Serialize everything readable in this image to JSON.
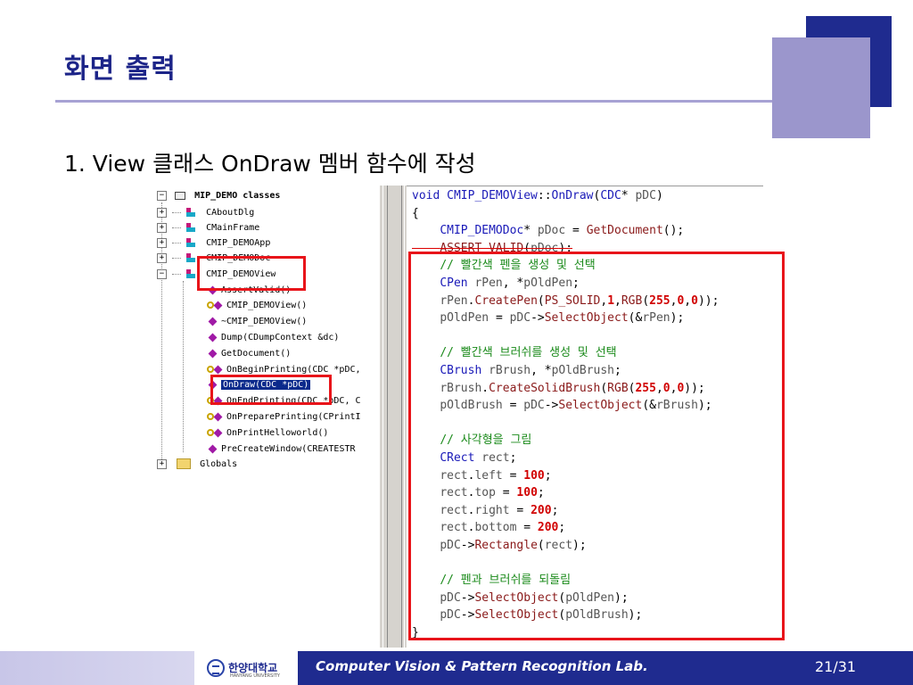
{
  "slide": {
    "title": "화면 출력",
    "subtitle": "1. View 클래스 OnDraw 멤버 함수에 작성"
  },
  "tree": {
    "root": "MIP_DEMO classes",
    "items": [
      {
        "label": "CAboutDlg",
        "kind": "class"
      },
      {
        "label": "CMainFrame",
        "kind": "class"
      },
      {
        "label": "CMIP_DEMOApp",
        "kind": "class"
      },
      {
        "label": "CMIP_DEMODoc",
        "kind": "class"
      },
      {
        "label": "CMIP_DEMOView",
        "kind": "class"
      },
      {
        "label": "AssertValid()",
        "kind": "method"
      },
      {
        "label": "CMIP_DEMOView()",
        "kind": "protected"
      },
      {
        "label": "~CMIP_DEMOView()",
        "kind": "method"
      },
      {
        "label": "Dump(CDumpContext &dc)",
        "kind": "method"
      },
      {
        "label": "GetDocument()",
        "kind": "method"
      },
      {
        "label": "OnBeginPrinting(CDC *pDC,",
        "kind": "protected"
      },
      {
        "label": "OnDraw(CDC *pDC)",
        "kind": "method-selected"
      },
      {
        "label": "OnEndPrinting(CDC *pDC, C",
        "kind": "protected"
      },
      {
        "label": "OnPreparePrinting(CPrintI",
        "kind": "protected"
      },
      {
        "label": "OnPrintHelloworld()",
        "kind": "protected"
      },
      {
        "label": "PreCreateWindow(CREATESTR",
        "kind": "method"
      },
      {
        "label": "Globals",
        "kind": "folder"
      }
    ]
  },
  "code": {
    "lines": [
      "void CMIP_DEMOView::OnDraw(CDC* pDC)",
      "{",
      "    CMIP_DEMODoc* pDoc = GetDocument();",
      "    ASSERT_VALID(pDoc);",
      "    // 빨간색 펜을 생성 및 선택",
      "    CPen rPen, *pOldPen;",
      "    rPen.CreatePen(PS_SOLID,1,RGB(255,0,0));",
      "    pOldPen = pDC->SelectObject(&rPen);",
      "",
      "    // 빨간색 브러쉬를 생성 및 선택",
      "    CBrush rBrush, *pOldBrush;",
      "    rBrush.CreateSolidBrush(RGB(255,0,0));",
      "    pOldBrush = pDC->SelectObject(&rBrush);",
      "",
      "    // 사각형을 그림",
      "    CRect rect;",
      "    rect.left = 100;",
      "    rect.top = 100;",
      "    rect.right = 200;",
      "    rect.bottom = 200;",
      "    pDC->Rectangle(rect);",
      "",
      "    // 펜과 브러쉬를 되돌림",
      "    pDC->SelectObject(pOldPen);",
      "    pDC->SelectObject(pOldBrush);",
      "}"
    ]
  },
  "footer": {
    "university": "한양대학교",
    "university_sub": "HANYANG UNIVERSITY",
    "lab": "Computer Vision & Pattern Recognition Lab.",
    "page": "21/31"
  },
  "colors": {
    "title": "#1c2488",
    "accent_dark": "#1f2b8f",
    "accent_light": "#9b96cc",
    "highlight": "#e8141a"
  }
}
